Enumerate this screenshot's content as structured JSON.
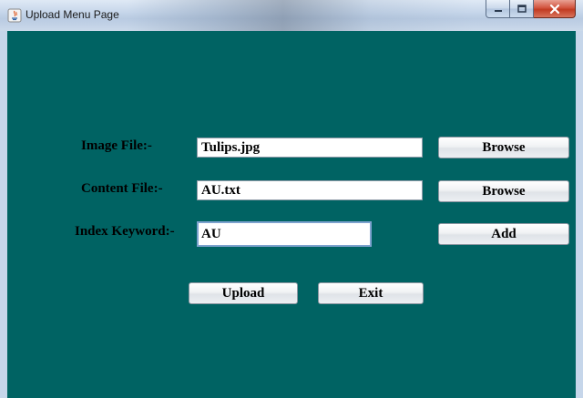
{
  "window": {
    "title": "Upload Menu Page",
    "controls": {
      "minimize": "minimize",
      "maximize": "maximize",
      "close": "close"
    }
  },
  "form": {
    "image_file": {
      "label": "Image File:-",
      "value": "Tulips.jpg",
      "button": "Browse"
    },
    "content_file": {
      "label": "Content File:-",
      "value": "AU.txt",
      "button": "Browse"
    },
    "index_keyword": {
      "label": "Index Keyword:-",
      "value": "AU",
      "button": "Add"
    }
  },
  "actions": {
    "upload": "Upload",
    "exit": "Exit"
  },
  "colors": {
    "background": "#006363",
    "titlebar": "#c6d6ea",
    "close": "#c23b22"
  }
}
